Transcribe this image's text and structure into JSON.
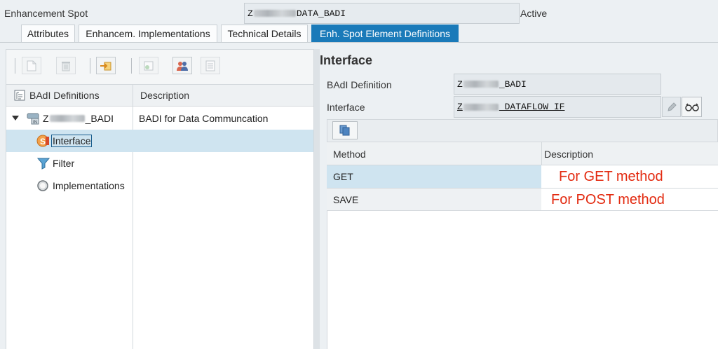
{
  "header": {
    "spot_label": "Enhancement Spot",
    "spot_value_prefix": "Z",
    "spot_value_suffix": "DATA_BADI",
    "status": "Active"
  },
  "tabs": [
    {
      "label": "Attributes"
    },
    {
      "label": "Enhancem. Implementations"
    },
    {
      "label": "Technical Details"
    },
    {
      "label": "Enh. Spot Element Definitions",
      "active": true
    }
  ],
  "tree": {
    "columns": [
      "BAdI Definitions",
      "Description"
    ],
    "rows": [
      {
        "label_prefix": "Z",
        "label_suffix": "_BADI",
        "description": "BADI for Data Communcation",
        "expanded": true
      },
      {
        "label": "Interface",
        "selected": true
      },
      {
        "label": "Filter"
      },
      {
        "label": "Implementations"
      }
    ]
  },
  "details": {
    "title": "Interface",
    "badi_label": "BAdI Definition",
    "badi_prefix": "Z",
    "badi_suffix": "_BADI",
    "interface_label": "Interface",
    "interface_prefix": "Z",
    "interface_suffix": "_DATAFLOW_IF"
  },
  "methods": {
    "columns": [
      "Method",
      "Description"
    ],
    "rows": [
      {
        "method": "GET",
        "description": "For GET method",
        "selected": true
      },
      {
        "method": "SAVE",
        "description": "For POST method"
      }
    ]
  },
  "colors": {
    "accent": "#1a7ab9",
    "selected_row": "#cfe4f0",
    "annotation": "#e32a10"
  }
}
